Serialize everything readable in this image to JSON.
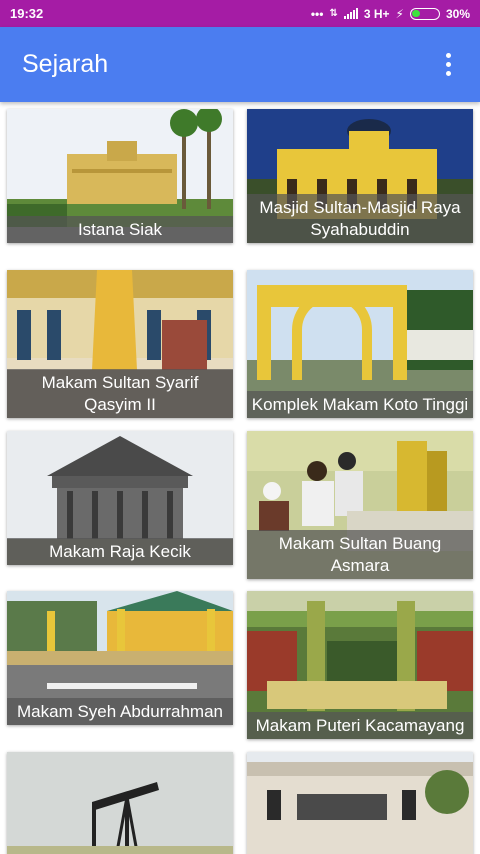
{
  "status": {
    "time": "19:32",
    "network": "3 H+",
    "battery": "30%"
  },
  "appbar": {
    "title": "Sejarah",
    "menu_icon": "more-vert-icon"
  },
  "items": [
    {
      "label": "Istana Siak"
    },
    {
      "label": "Masjid Sultan-Masjid Raya Syahabuddin"
    },
    {
      "label": "Makam Sultan Syarif Qasyim II"
    },
    {
      "label": "Komplek Makam Koto Tinggi"
    },
    {
      "label": "Makam Raja Kecik"
    },
    {
      "label": "Makam Sultan Buang Asmara"
    },
    {
      "label": "Makam Syeh Abdurrahman"
    },
    {
      "label": "Makam Puteri Kacamayang"
    },
    {
      "label": ""
    },
    {
      "label": ""
    }
  ],
  "colors": {
    "statusbar": "#a51ca5",
    "appbar": "#4b7df0"
  }
}
